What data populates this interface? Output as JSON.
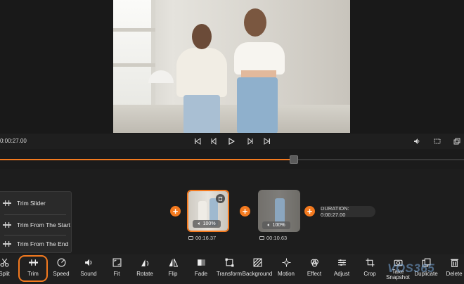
{
  "player": {
    "current_time": "0:00:27.00",
    "controls": [
      "skip-to-start",
      "previous-frame",
      "play",
      "next-frame",
      "skip-to-end"
    ],
    "right_controls": [
      "volume",
      "aspect-ratio",
      "fullscreen"
    ],
    "progress_fraction": 0.63
  },
  "trim_menu": {
    "items": [
      {
        "label": "Trim Slider",
        "icon": "trim-slider-icon"
      },
      {
        "label": "Trim From The Start",
        "icon": "trim-start-icon"
      },
      {
        "label": "Trim From The End",
        "icon": "trim-end-icon"
      }
    ]
  },
  "timeline": {
    "clips": [
      {
        "volume": "100%",
        "duration": "00:16.37",
        "selected": true
      },
      {
        "volume": "100%",
        "duration": "00:10.63",
        "selected": false
      }
    ],
    "total_duration": "DURATION: 0:00:27.00"
  },
  "toolbar": {
    "tools": [
      {
        "label": "Split",
        "icon": "scissors-icon"
      },
      {
        "label": "Trim",
        "icon": "trim-icon"
      },
      {
        "label": "Speed",
        "icon": "speedometer-icon"
      },
      {
        "label": "Sound",
        "icon": "speaker-icon"
      },
      {
        "label": "Fit",
        "icon": "fit-icon"
      },
      {
        "label": "Rotate",
        "icon": "rotate-icon"
      },
      {
        "label": "Flip",
        "icon": "flip-icon"
      },
      {
        "label": "Fade",
        "icon": "fade-icon"
      },
      {
        "label": "Transform",
        "icon": "transform-icon"
      },
      {
        "label": "Background",
        "icon": "background-icon"
      },
      {
        "label": "Motion",
        "icon": "motion-icon"
      },
      {
        "label": "Effect",
        "icon": "effect-icon"
      },
      {
        "label": "Adjust",
        "icon": "adjust-icon"
      },
      {
        "label": "Crop",
        "icon": "crop-icon"
      },
      {
        "label": "Take Snapshot",
        "icon": "camera-icon"
      },
      {
        "label": "Duplicate",
        "icon": "duplicate-icon"
      },
      {
        "label": "Delete",
        "icon": "trash-icon"
      }
    ],
    "highlighted": "Trim"
  },
  "watermark": "VOS365",
  "colors": {
    "accent": "#f47a1f",
    "panel": "#1f1f1f",
    "menu": "#2a2a2a"
  }
}
